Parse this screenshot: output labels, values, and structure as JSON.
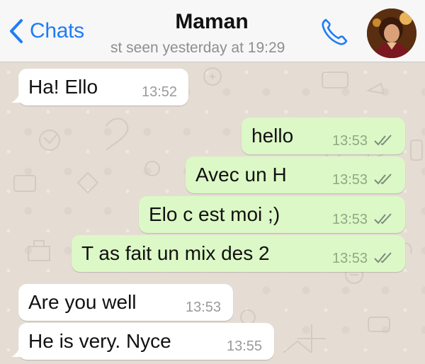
{
  "header": {
    "back_label": "Chats",
    "contact_name": "Maman",
    "status": "st seen yesterday at 19:29"
  },
  "colors": {
    "accent": "#1f7cf7",
    "incoming_bubble": "#ffffff",
    "outgoing_bubble": "#dcf8c6",
    "chat_background": "#e5ddd4"
  },
  "icons": {
    "back": "chevron-left-icon",
    "call": "phone-icon",
    "read_receipt": "double-check-icon"
  },
  "messages": [
    {
      "direction": "incoming",
      "text": "Ha! Ello",
      "time": "13:52"
    },
    {
      "direction": "outgoing",
      "text": "hello",
      "time": "13:53",
      "read": true
    },
    {
      "direction": "outgoing",
      "text": "Avec un H",
      "time": "13:53",
      "read": true
    },
    {
      "direction": "outgoing",
      "text": "Elo c est moi ;)",
      "time": "13:53",
      "read": true
    },
    {
      "direction": "outgoing",
      "text": "T as fait un mix des 2",
      "time": "13:53",
      "read": true
    },
    {
      "direction": "incoming",
      "text": "Are you well",
      "time": "13:53"
    },
    {
      "direction": "incoming",
      "text": "He is very. Nyce",
      "time": "13:55"
    }
  ]
}
